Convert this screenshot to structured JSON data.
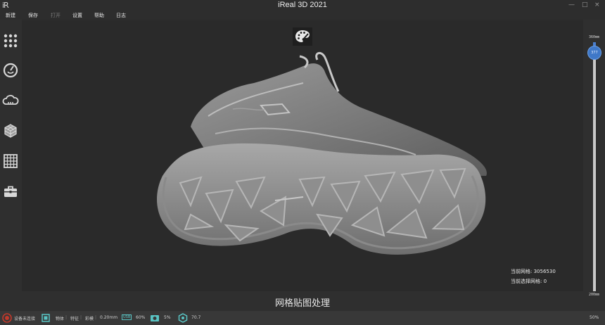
{
  "titlebar": {
    "logo": "iR",
    "title": "iReal 3D 2021",
    "minimize": "—",
    "maximize": "□",
    "close": "×"
  },
  "menu": {
    "items": [
      {
        "label": "新建",
        "enabled": true
      },
      {
        "label": "保存",
        "enabled": true
      },
      {
        "label": "打开",
        "enabled": false
      },
      {
        "label": "设置",
        "enabled": true
      },
      {
        "label": "帮助",
        "enabled": true
      },
      {
        "label": "日志",
        "enabled": true
      }
    ]
  },
  "toolbar": {
    "tools": [
      "grid-dots-icon",
      "scan-dial-icon",
      "cloud-mesh-icon",
      "mesh-cube-icon",
      "grid-map-icon",
      "toolbox-icon"
    ]
  },
  "viewport": {
    "palette_icon": "palette-icon",
    "mesh_count_label": "当前网格:",
    "mesh_count_value": "3056530",
    "selected_mesh_label": "当前选择网格:",
    "selected_mesh_value": "0"
  },
  "scale": {
    "top": "360mm",
    "bottom": "200mm",
    "knob_value": "377"
  },
  "caption": "网格贴图处理",
  "status": {
    "device": "设备未连接",
    "mode_items": [
      "物体",
      "特征",
      "彩模",
      "0.20mm"
    ],
    "fps_badge": "USB",
    "fps_value": "60%",
    "camera_value": "5%",
    "temp_value": "70.7",
    "zoom": "50%"
  },
  "colors": {
    "accent": "#3f78c8",
    "device_status": "#c0392b",
    "status_teal": "#59c4c4"
  }
}
